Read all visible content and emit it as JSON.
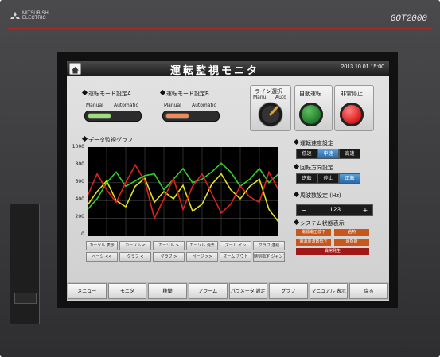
{
  "device": {
    "brand": [
      "MITSUBISHI",
      "ELECTRIC"
    ],
    "model": "GOT2000"
  },
  "header": {
    "title": "運転監視モニタ",
    "datetime": "2013.10.01  15:00"
  },
  "mode_a": {
    "label": "運転モード設定A",
    "left": "Manual",
    "right": "Automatic",
    "indicator_color": "#9be07a"
  },
  "mode_b": {
    "label": "運転モード設定B",
    "left": "Manual",
    "right": "Automatic",
    "indicator_color": "#f08a5a"
  },
  "line_select": {
    "label": "ライン選択",
    "left": "Manu",
    "right": "Auto"
  },
  "auto_run": {
    "label": "自動運転",
    "color": "#1f7a2a"
  },
  "emergency_stop": {
    "label": "非常停止",
    "color": "#d81818"
  },
  "chart_data": {
    "type": "line",
    "title": "データ監視グラフ",
    "yticks": [
      "1000",
      "800",
      "600",
      "400",
      "200",
      "0"
    ],
    "ylim": [
      0,
      1000
    ],
    "x": [
      0,
      1,
      2,
      3,
      4,
      5,
      6,
      7,
      8,
      9,
      10,
      11,
      12,
      13,
      14,
      15,
      16,
      17,
      18,
      19,
      20
    ],
    "series": [
      {
        "color": "#e0e020",
        "values": [
          350,
          500,
          620,
          400,
          330,
          560,
          650,
          380,
          500,
          420,
          570,
          280,
          360,
          580,
          700,
          520,
          420,
          560,
          640,
          300,
          160
        ]
      },
      {
        "color": "#30d030",
        "values": [
          300,
          420,
          600,
          720,
          560,
          620,
          680,
          700,
          520,
          640,
          760,
          600,
          640,
          720,
          820,
          720,
          560,
          640,
          760,
          600,
          700
        ]
      },
      {
        "color": "#e02020",
        "values": [
          450,
          700,
          520,
          380,
          600,
          800,
          620,
          200,
          420,
          650,
          300,
          560,
          700,
          480,
          260,
          360,
          560,
          440,
          380,
          720,
          520
        ]
      }
    ],
    "grid": true
  },
  "graph_buttons": [
    [
      "カーソル 表示",
      "カーソル <",
      "カーソル >",
      "カーソル 消去",
      "ズーム イン",
      "グラフ 連結"
    ],
    [
      "ページ <<",
      "グラフ <",
      "グラフ >",
      "ページ >>",
      "ズーム アウト",
      "時刻指定 ジャンプ"
    ]
  ],
  "speed": {
    "label": "運転速度設定",
    "options": [
      "低速",
      "中速",
      "高速"
    ],
    "selected": 1
  },
  "direction": {
    "label": "回転方向設定",
    "options": [
      "逆転",
      "停止",
      "正転"
    ],
    "selected": 2
  },
  "frequency": {
    "label": "周波数設定 (Hz)",
    "minus": "−",
    "value": "123",
    "plus": "+"
  },
  "system_status": {
    "label": "システム状態表示",
    "items": [
      {
        "text": "電源電圧低下",
        "color": "#c8571c"
      },
      {
        "text": "過熱",
        "color": "#c8571c"
      },
      {
        "text": "電源周波数低下",
        "color": "#c8571c"
      },
      {
        "text": "過負荷",
        "color": "#c8571c"
      },
      {
        "text": "異常発生",
        "color": "#a01818"
      }
    ]
  },
  "menu": [
    "メニュー",
    "モニタ",
    "稼働",
    "アラーム",
    "パラメータ 設定",
    "グラフ",
    "マニュアル 表示",
    "戻る"
  ]
}
